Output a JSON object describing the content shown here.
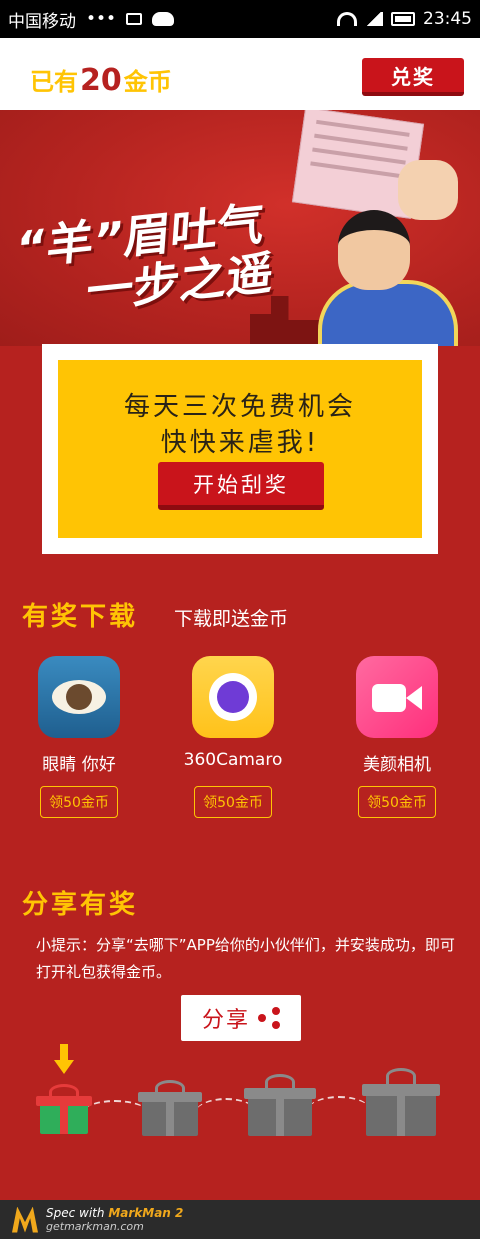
{
  "status_bar": {
    "carrier": "中国移动",
    "dots": "•••",
    "time": "23:45"
  },
  "header": {
    "coins_prefix": "已有",
    "coins_count": "20",
    "coins_suffix": "金币",
    "redeem_label": "兑奖"
  },
  "banner": {
    "slogan_line1": "“羊”眉吐气",
    "slogan_line2": "一步之遥"
  },
  "scratch_card": {
    "line1": "每天三次免费机会",
    "line2": "快快来虐我!",
    "button_label": "开始刮奖"
  },
  "download_section": {
    "title": "有奖下载",
    "subtitle": "下载即送金币",
    "apps": [
      {
        "name": "眼睛 你好",
        "button": "领50金币",
        "icon": "eye-app-icon"
      },
      {
        "name": "360Camaro",
        "button": "领50金币",
        "icon": "camera-app-icon"
      },
      {
        "name": "美颜相机",
        "button": "领50金币",
        "icon": "video-app-icon"
      }
    ]
  },
  "share_section": {
    "title": "分享有奖",
    "tip": "小提示：分享“去哪下”APP给你的小伙伴们，并安装成功，即可打开礼包获得金币。",
    "share_label": "分享"
  },
  "footer": {
    "spec_text": "Spec with",
    "brand": "MarkMan 2",
    "url": "getmarkman.com"
  },
  "colors": {
    "brand_red": "#b62220",
    "gold": "#ffc404",
    "accent_red": "#b3221d"
  }
}
